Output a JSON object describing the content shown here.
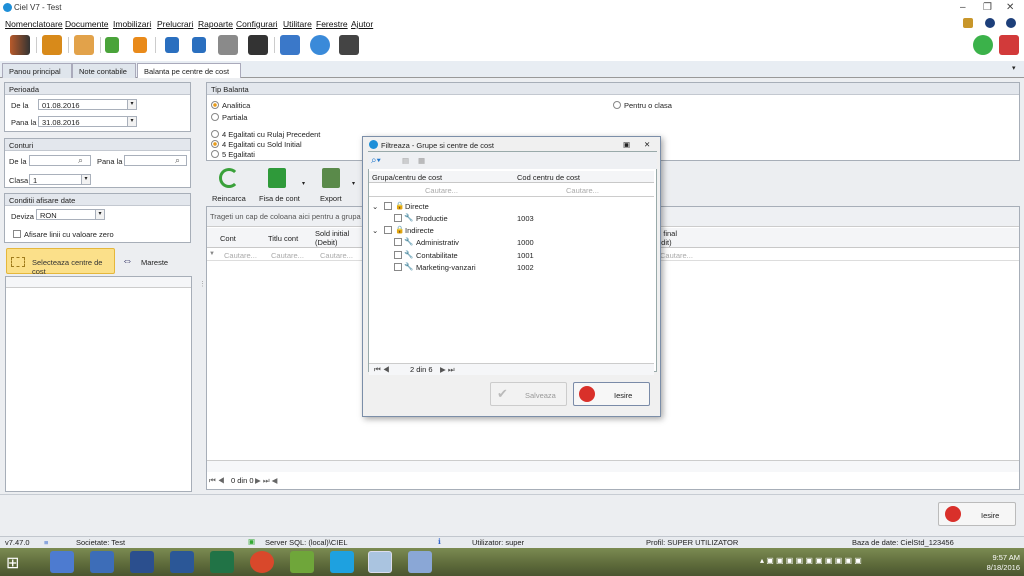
{
  "app": {
    "title": "Ciel V7 - Test"
  },
  "menu": [
    "Nomenclatoare",
    "Documente",
    "Imobilizari",
    "Prelucrari",
    "Rapoarte",
    "Configurari",
    "Utilitare",
    "Ferestre",
    "Ajutor"
  ],
  "tabs": [
    {
      "label": "Panou principal"
    },
    {
      "label": "Note contabile"
    },
    {
      "label": "Balanta pe centre de cost"
    }
  ],
  "perioada": {
    "title": "Perioada",
    "de_la_label": "De la",
    "de_la": "01.08.2016",
    "pana_la_label": "Pana la",
    "pana_la": "31.08.2016"
  },
  "conturi": {
    "title": "Conturi",
    "de_la_label": "De la",
    "pana_la_label": "Pana la",
    "clasa_label": "Clasa",
    "clasa": "1"
  },
  "conditii": {
    "title": "Conditii afisare date",
    "deviza_label": "Deviza",
    "deviza": "RON",
    "zero_label": "Afisare linii cu valoare zero"
  },
  "select_btn": "Selecteaza centre de cost",
  "mareste": "Mareste",
  "tip": {
    "title": "Tip Balanta",
    "analitica": "Analitica",
    "partiala": "Partiala",
    "pentru_clasa": "Pentru o clasa",
    "opt4": "4 Egalitati cu Rulaj Precedent",
    "opt4b": "4 Egalitati cu Sold Initial",
    "opt5": "5 Egalitati"
  },
  "actions": {
    "reincarca": "Reincarca",
    "fisa": "Fisa de cont",
    "export": "Export"
  },
  "grid": {
    "group_hint": "Trageti un cap de coloana aici pentru a grupa in fu",
    "cols": [
      "Cont",
      "Titlu cont",
      "Sold initial\n(Debit)"
    ],
    "col_final": "d final\nedit)",
    "search": "Cautare...",
    "pager": "0 din 0"
  },
  "dialog": {
    "title": "Filtreaza - Grupe si centre de cost",
    "col1": "Grupa/centru de cost",
    "col2": "Cod centru de cost",
    "search": "Cautare...",
    "rows": [
      {
        "name": "Directe",
        "code": "",
        "level": 0
      },
      {
        "name": "Productie",
        "code": "1003",
        "level": 1
      },
      {
        "name": "Indirecte",
        "code": "",
        "level": 0
      },
      {
        "name": "Administrativ",
        "code": "1000",
        "level": 1
      },
      {
        "name": "Contabilitate",
        "code": "1001",
        "level": 1
      },
      {
        "name": "Marketing-vanzari",
        "code": "1002",
        "level": 1
      }
    ],
    "pager": "2 din 6",
    "save": "Salveaza",
    "exit": "Iesire"
  },
  "bottom": {
    "exit": "Iesire"
  },
  "status": {
    "version": "v7.47.0",
    "societate": "Societate: Test",
    "server": "Server SQL: (local)\\CIEL",
    "utilizator": "Utilizator: super",
    "profil": "Profil: SUPER UTILIZATOR",
    "baza": "Baza de date: CielStd_123456"
  },
  "clock": {
    "time": "9:57 AM",
    "date": "8/18/2016"
  }
}
